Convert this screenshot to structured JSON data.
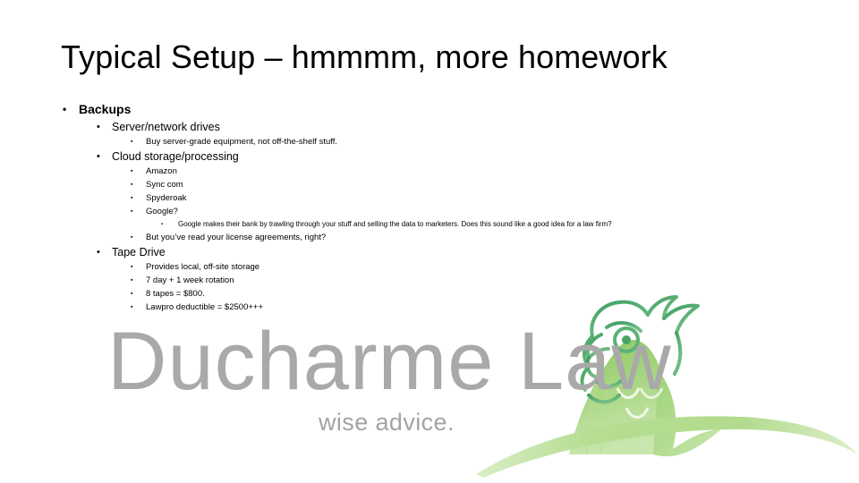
{
  "slide": {
    "title": "Typical Setup – hmmmm, more homework",
    "background_color": "#ffffff",
    "text_color": "#000000",
    "outline": [
      {
        "level": 1,
        "bullet": "•",
        "text": "Backups"
      },
      {
        "level": 2,
        "bullet": "•",
        "text": "Server/network drives"
      },
      {
        "level": 3,
        "bullet": "▪",
        "text": "Buy server-grade equipment, not off-the-shelf stuff."
      },
      {
        "level": 2,
        "bullet": "•",
        "text": "Cloud storage/processing"
      },
      {
        "level": 3,
        "bullet": "▪",
        "text": "Amazon"
      },
      {
        "level": 3,
        "bullet": "▪",
        "text": "Sync com"
      },
      {
        "level": 3,
        "bullet": "▪",
        "text": "Spyderoak"
      },
      {
        "level": 3,
        "bullet": "▪",
        "text": "Google?"
      },
      {
        "level": 4,
        "bullet": "▪",
        "text": "Google makes their bank by trawling through your stuff and selling the data to marketers. Does this sound like a good idea for a law firm?"
      },
      {
        "level": 3,
        "bullet": "▪",
        "text": "But you’ve read your license agreements, right?"
      },
      {
        "level": 2,
        "bullet": "•",
        "text": "Tape Drive"
      },
      {
        "level": 3,
        "bullet": "▪",
        "text": "Provides local, off-site storage"
      },
      {
        "level": 3,
        "bullet": "▪",
        "text": "7 day + 1 week rotation"
      },
      {
        "level": 3,
        "bullet": "▪",
        "text": "8 tapes = $800."
      },
      {
        "level": 3,
        "bullet": "▪",
        "text": "Lawpro deductible = $2500+++"
      }
    ]
  },
  "logo": {
    "wordmark": "Ducharme Law",
    "tagline": "wise advice.",
    "wordmark_color": "#a9a9a9",
    "tagline_color": "#a3a3a3",
    "bird_head_color": "#63b97a",
    "bird_body_color_light": "#c3e2a4",
    "bird_body_color_mid": "#9ed173",
    "branch_color": "#bcdf9b"
  }
}
